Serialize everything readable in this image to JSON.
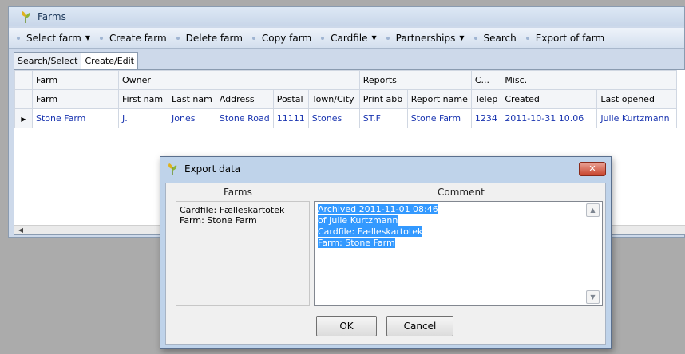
{
  "window": {
    "title": "Farms"
  },
  "menu": [
    {
      "label": "Select farm",
      "has_caret": true
    },
    {
      "label": "Create farm",
      "has_caret": false
    },
    {
      "label": "Delete farm",
      "has_caret": false
    },
    {
      "label": "Copy farm",
      "has_caret": false
    },
    {
      "label": "Cardfile",
      "has_caret": true
    },
    {
      "label": "Partnerships",
      "has_caret": true
    },
    {
      "label": "Search",
      "has_caret": false
    },
    {
      "label": "Export of farm",
      "has_caret": false
    }
  ],
  "tabs": [
    {
      "label": "Search/Select",
      "active": false
    },
    {
      "label": "Create/Edit",
      "active": true
    }
  ],
  "grid": {
    "groups": [
      {
        "label": "Farm",
        "span": 1
      },
      {
        "label": "Owner",
        "span": 5
      },
      {
        "label": "Reports",
        "span": 2
      },
      {
        "label": "C...",
        "span": 1
      },
      {
        "label": "Misc.",
        "span": 2
      }
    ],
    "columns": [
      "Farm",
      "First nam",
      "Last nam",
      "Address",
      "Postal",
      "Town/City",
      "Print abb",
      "Report name",
      "Telep",
      "Created",
      "Last opened"
    ],
    "rows": [
      [
        "Stone Farm",
        "J.",
        "Jones",
        "Stone Road",
        "11111",
        "Stones",
        "ST.F",
        "Stone Farm",
        "1234",
        "2011-10-31 10.06",
        "Julie Kurtzmann"
      ]
    ],
    "current_row_marker": "▶"
  },
  "dialog": {
    "title": "Export data",
    "farms_header": "Farms",
    "comment_header": "Comment",
    "farms_lines": [
      "Cardfile: Fælleskartotek",
      "Farm: Stone Farm"
    ],
    "comment_lines": [
      "Archived 2011-11-01 08:46",
      "of Julie Kurtzmann",
      "Cardfile: Fælleskartotek",
      "Farm: Stone Farm"
    ],
    "ok_label": "OK",
    "cancel_label": "Cancel",
    "close_label": "✕"
  }
}
